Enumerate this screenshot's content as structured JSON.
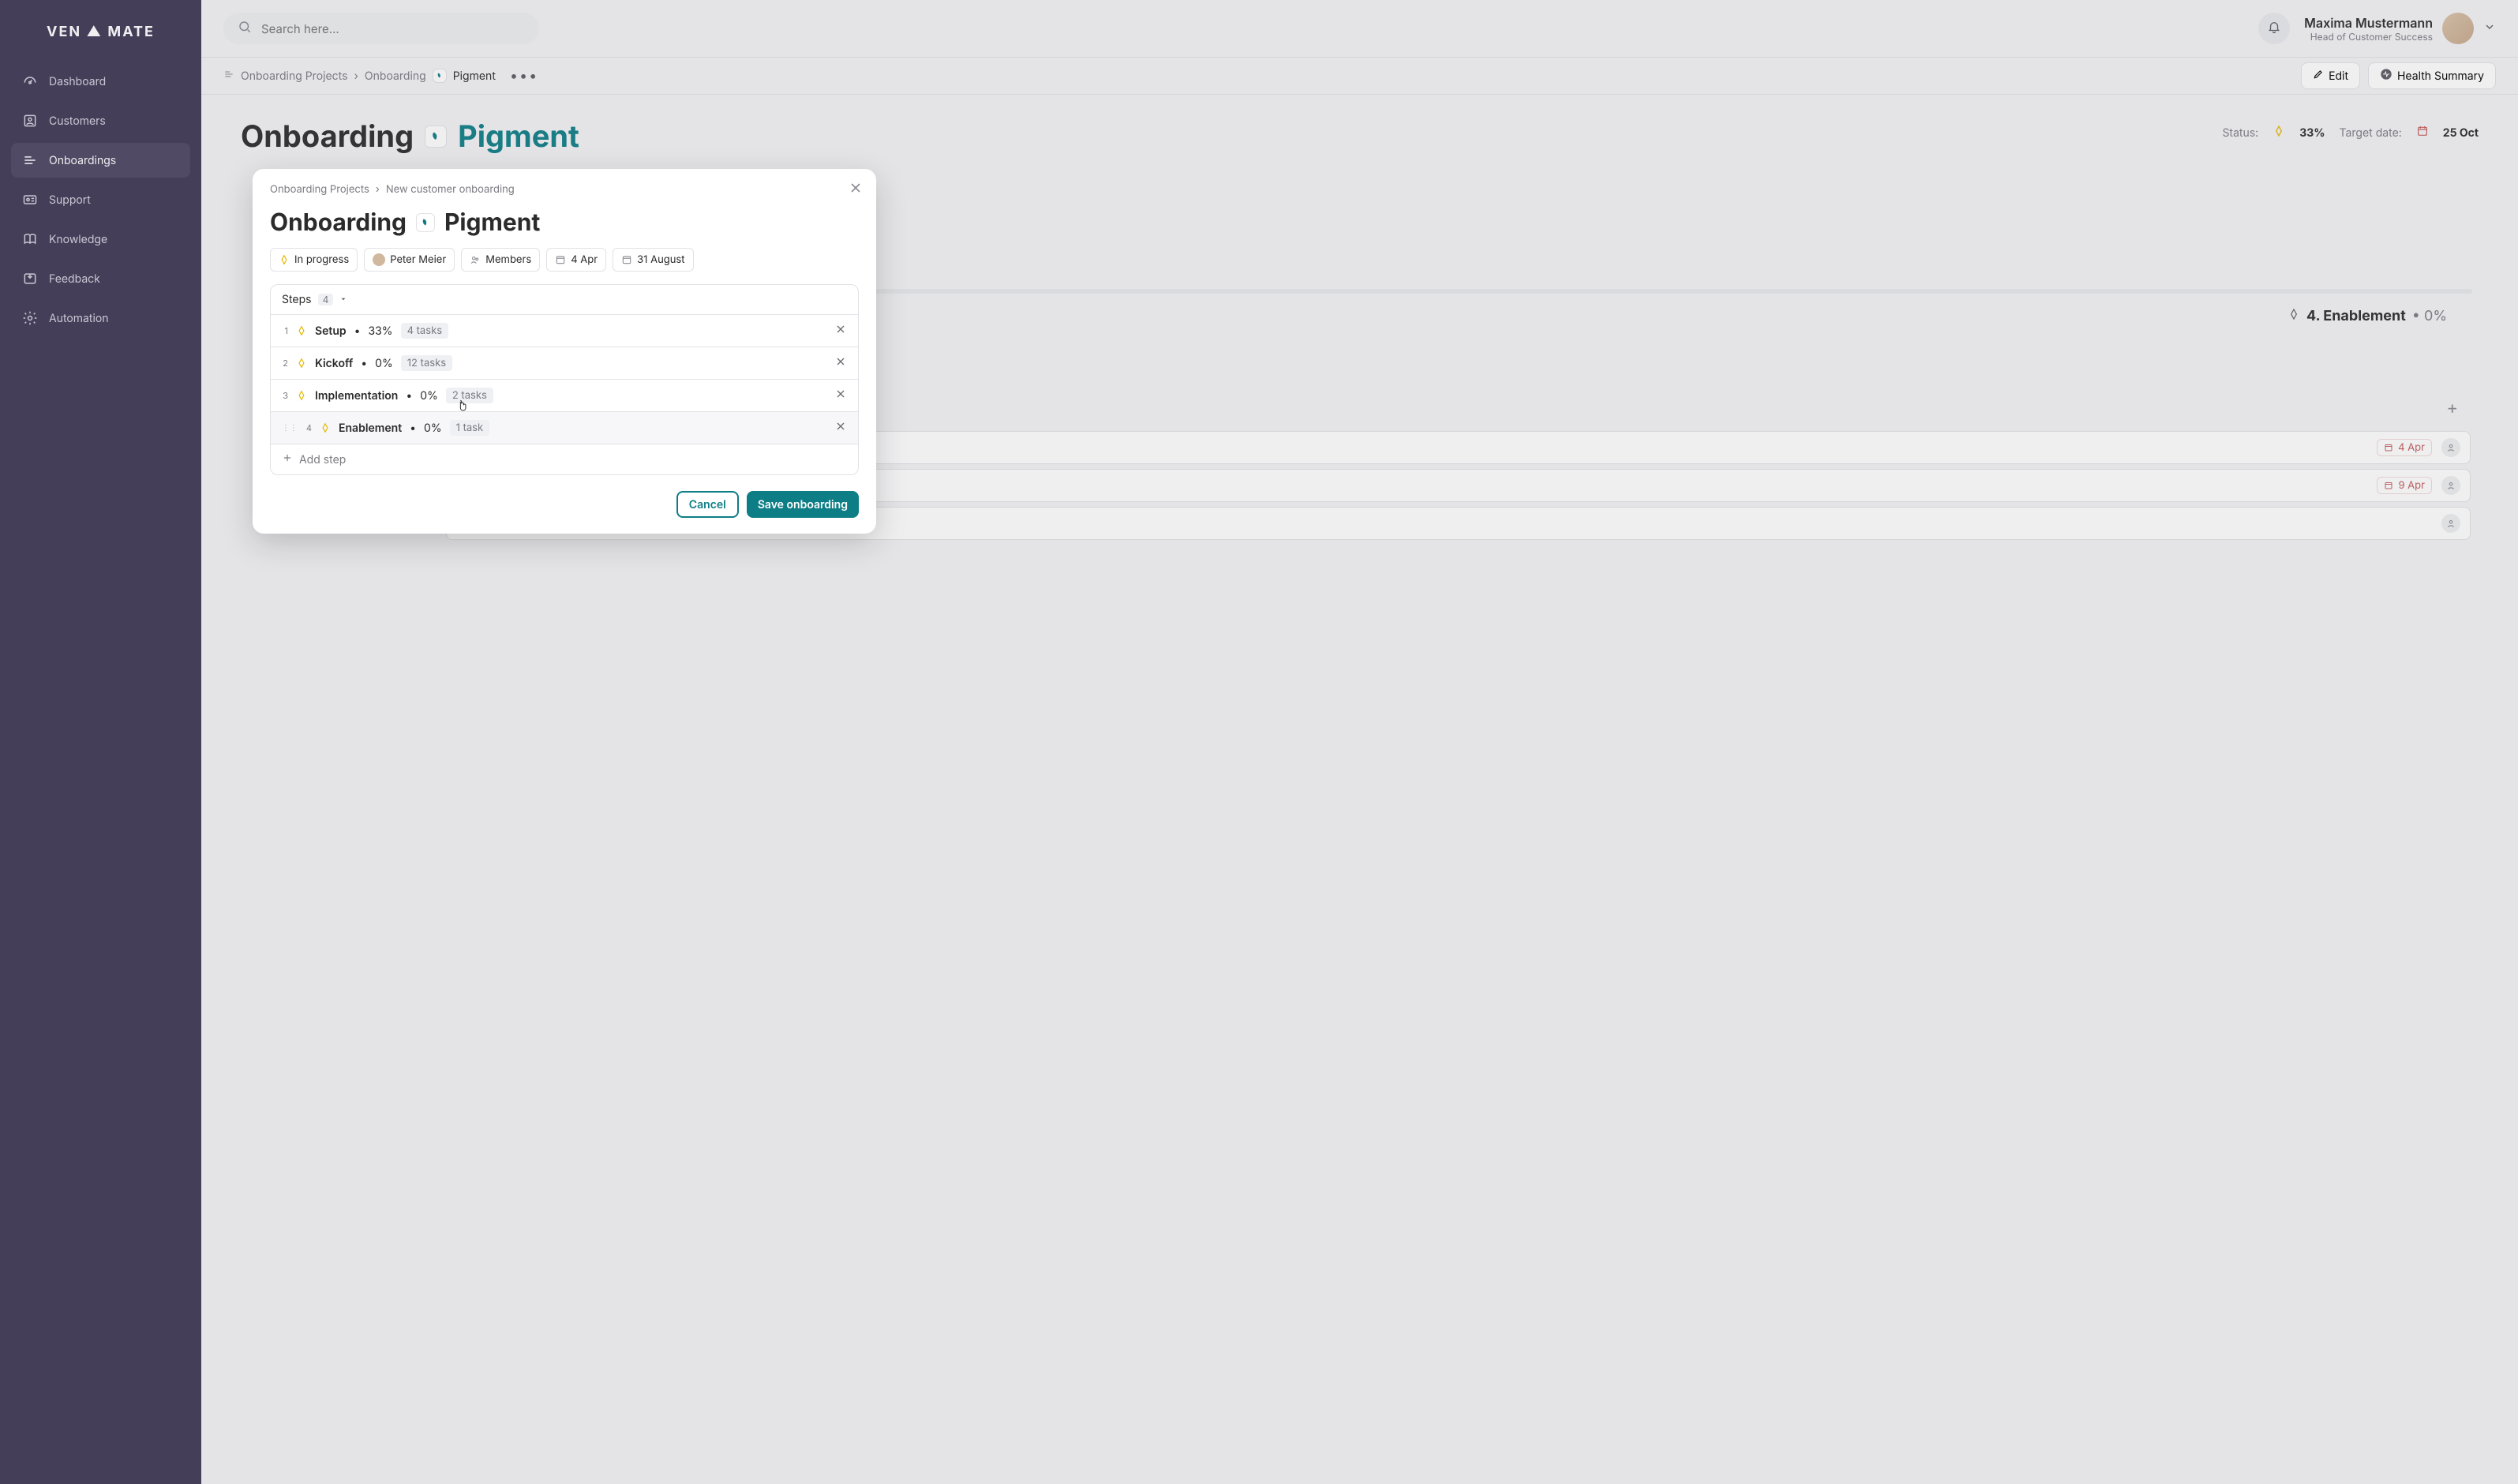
{
  "brand": "VEN ▲ MATE",
  "search_placeholder": "Search here...",
  "user": {
    "name": "Maxima Mustermann",
    "role": "Head of Customer Success"
  },
  "sidebar": {
    "items": [
      {
        "label": "Dashboard"
      },
      {
        "label": "Customers"
      },
      {
        "label": "Onboardings"
      },
      {
        "label": "Support"
      },
      {
        "label": "Knowledge"
      },
      {
        "label": "Feedback"
      },
      {
        "label": "Automation"
      }
    ],
    "active_index": 2
  },
  "breadcrumb": {
    "root": "Onboarding Projects",
    "mid": "Onboarding",
    "leaf": "Pigment"
  },
  "crumb_actions": {
    "edit": "Edit",
    "health": "Health Summary"
  },
  "page_title": {
    "prefix": "Onboarding",
    "company": "Pigment"
  },
  "page_status": {
    "status_label": "Status:",
    "status_pct": "33%",
    "target_label": "Target date:",
    "target_date": "25 Oct"
  },
  "bg_step": {
    "index": "4.",
    "name": "Enablement",
    "pct": "0%"
  },
  "bg_rows": [
    {
      "date": "4 Apr"
    },
    {
      "date": "9 Apr"
    },
    {
      "date": ""
    }
  ],
  "modal": {
    "crumb_root": "Onboarding Projects",
    "crumb_leaf": "New customer onboarding",
    "title_prefix": "Onboarding",
    "title_company": "Pigment",
    "chips": {
      "status": "In progress",
      "owner": "Peter Meier",
      "members": "Members",
      "start": "4 Apr",
      "end": "31 August"
    },
    "steps_label": "Steps",
    "steps_count": "4",
    "steps": [
      {
        "n": "1",
        "name": "Setup",
        "pct": "33%",
        "tasks": "4 tasks"
      },
      {
        "n": "2",
        "name": "Kickoff",
        "pct": "0%",
        "tasks": "12 tasks"
      },
      {
        "n": "3",
        "name": "Implementation",
        "pct": "0%",
        "tasks": "2 tasks"
      },
      {
        "n": "4",
        "name": "Enablement",
        "pct": "0%",
        "tasks": "1 task"
      }
    ],
    "add_step": "Add step",
    "cancel": "Cancel",
    "save": "Save onboarding"
  }
}
